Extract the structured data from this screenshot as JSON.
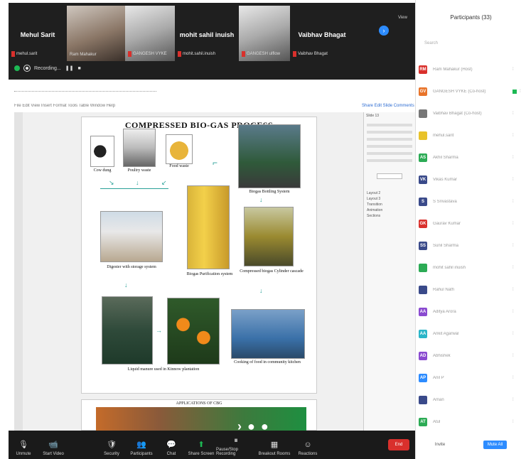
{
  "gallery": {
    "tiles": [
      {
        "name": "Mehul Sarit",
        "sub": "mehul.sarit"
      },
      {
        "name": "",
        "sub": "Ram Mahakur"
      },
      {
        "name": "",
        "sub": "GANGESH VYKE"
      },
      {
        "name": "mohit sahil inuish",
        "sub": "mohit.sahil.inuish"
      },
      {
        "name": "",
        "sub": "GANGESH ulflow"
      },
      {
        "name": "Vaibhav Bhagat",
        "sub": "Vaibhav Bhagat"
      }
    ],
    "view_label": "View",
    "recording_label": "Recording..."
  },
  "share": {
    "toolbar_text": "File  Edit  View  Insert  Format  Tools  Table  Window  Help",
    "right_labels": "Share  Edit Slide  Comments",
    "slide": {
      "title": "COMPRESSED BIO-GAS PROCESS",
      "captions": {
        "cow_dung": "Cow dung",
        "poultry": "Poultry waste",
        "food": "Food waste",
        "bottling": "Biogas Bottling System",
        "digester": "Digester with storage system",
        "purification": "Biogas Purification system",
        "cylinder": "Compressed biogas Cylinder cascade",
        "liquid": "Liquid manure used in Kinnow plantation",
        "cooking": "Cooking of food in community kitchen"
      }
    },
    "next_slide_title": "APPLICATIONS OF CBG",
    "side_pane": {
      "header": "Slide 13",
      "items": [
        "Layout 2",
        "Layout 3",
        "Transition",
        "Animation",
        "Sections"
      ]
    }
  },
  "controls": {
    "items": [
      {
        "icon": "microphone-icon",
        "label": "Unmute",
        "glyph": "🎙"
      },
      {
        "icon": "video-icon",
        "label": "Start Video",
        "glyph": "📹"
      },
      {
        "icon": "security-icon",
        "label": "Security",
        "glyph": "🛡"
      },
      {
        "icon": "participants-icon",
        "label": "Participants",
        "glyph": "👥"
      },
      {
        "icon": "chat-icon",
        "label": "Chat",
        "glyph": "💬"
      },
      {
        "icon": "share-screen-icon",
        "label": "Share Screen",
        "glyph": "⬆"
      },
      {
        "icon": "record-icon",
        "label": "Pause/Stop Recording",
        "glyph": "⏸"
      },
      {
        "icon": "breakout-icon",
        "label": "Breakout Rooms",
        "glyph": "▦"
      },
      {
        "icon": "reactions-icon",
        "label": "Reactions",
        "glyph": "☺"
      }
    ],
    "end_label": "End"
  },
  "participants": {
    "title": "Participants (33)",
    "search_placeholder": "Search",
    "list": [
      {
        "initials": "RM",
        "color": "#d9302c",
        "name": "Ram Mahakur (Host)",
        "video": false
      },
      {
        "initials": "GV",
        "color": "#e8742a",
        "name": "GANGESH VYKE (Co-host)",
        "video": true
      },
      {
        "initials": "",
        "color": "#777777",
        "name": "Vaibhav Bhagat (Co-host)",
        "video": false
      },
      {
        "initials": "",
        "color": "#e8c22a",
        "name": "mehul.sarit",
        "video": false
      },
      {
        "initials": "AS",
        "color": "#2cab55",
        "name": "Akhil Sharma",
        "video": false
      },
      {
        "initials": "VK",
        "color": "#3a4a8a",
        "name": "Vikas Kumar",
        "video": false
      },
      {
        "initials": "S",
        "color": "#3a4a8a",
        "name": "S Srivastava",
        "video": false
      },
      {
        "initials": "GK",
        "color": "#d9302c",
        "name": "Gaurav Kumar",
        "video": false
      },
      {
        "initials": "SS",
        "color": "#3a4a8a",
        "name": "Sunil Sharma",
        "video": false
      },
      {
        "initials": "",
        "color": "#2cab55",
        "name": "mohit sahil inuish",
        "video": false
      },
      {
        "initials": "",
        "color": "#3a4a8a",
        "name": "Rahul Nath",
        "video": false
      },
      {
        "initials": "AA",
        "color": "#8a4ad0",
        "name": "Aditya Arora",
        "video": false
      },
      {
        "initials": "AA",
        "color": "#2ab5c8",
        "name": "Ankit Agarwal",
        "video": false
      },
      {
        "initials": "AD",
        "color": "#8a4ad0",
        "name": "Abhishek",
        "video": false
      },
      {
        "initials": "AP",
        "color": "#2d8cff",
        "name": "Anil P",
        "video": false
      },
      {
        "initials": "",
        "color": "#3a4a8a",
        "name": "Aman",
        "video": false
      },
      {
        "initials": "AT",
        "color": "#2cab55",
        "name": "Atul",
        "video": false
      }
    ],
    "invite_label": "Invite",
    "mute_all_label": "Mute All"
  }
}
